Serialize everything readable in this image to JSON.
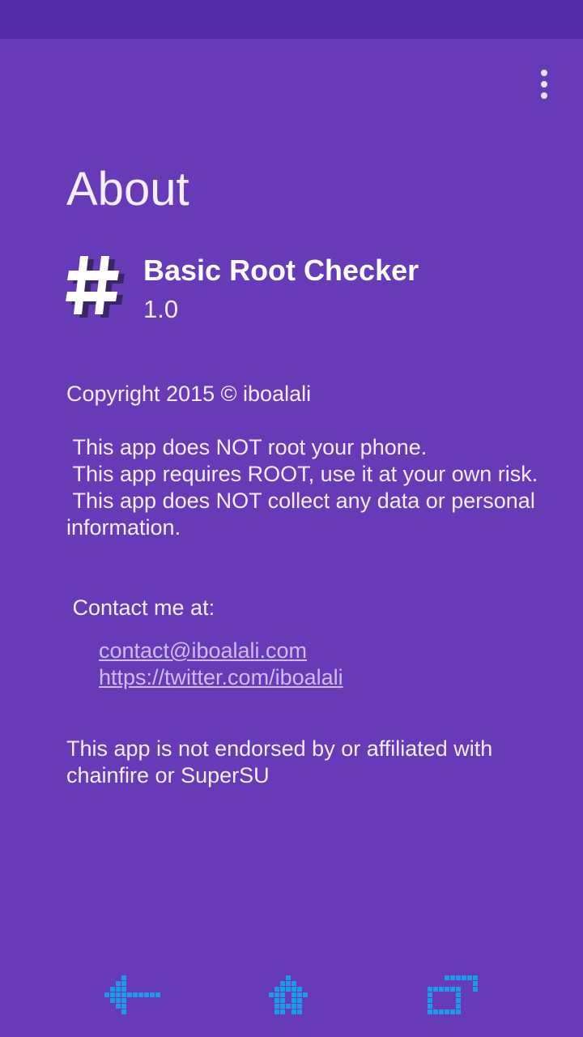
{
  "screen": {
    "title": "About",
    "icons": {
      "overflow_menu": "more-vert-icon",
      "app_icon": "hash-icon",
      "nav_back": "back-icon",
      "nav_home": "home-icon",
      "nav_recents": "recents-icon"
    },
    "colors": {
      "background": "#673ab7",
      "status_bar": "#512da8",
      "link": "#cdbdf5",
      "nav_icons": "#1e9be8"
    }
  },
  "app": {
    "name": "Basic Root Checker",
    "version": "1.0"
  },
  "about": {
    "copyright": "Copyright 2015 © iboalali",
    "disclaimers": [
      " This app does NOT root your phone.",
      " This app requires ROOT, use it at your own risk.",
      " This app does NOT collect any data or personal information."
    ],
    "contact_heading": " Contact me at:",
    "links": [
      "contact@iboalali.com",
      "https://twitter.com/iboalali"
    ],
    "endorsement": "This app is not endorsed by or affiliated with chainfire or SuperSU"
  }
}
